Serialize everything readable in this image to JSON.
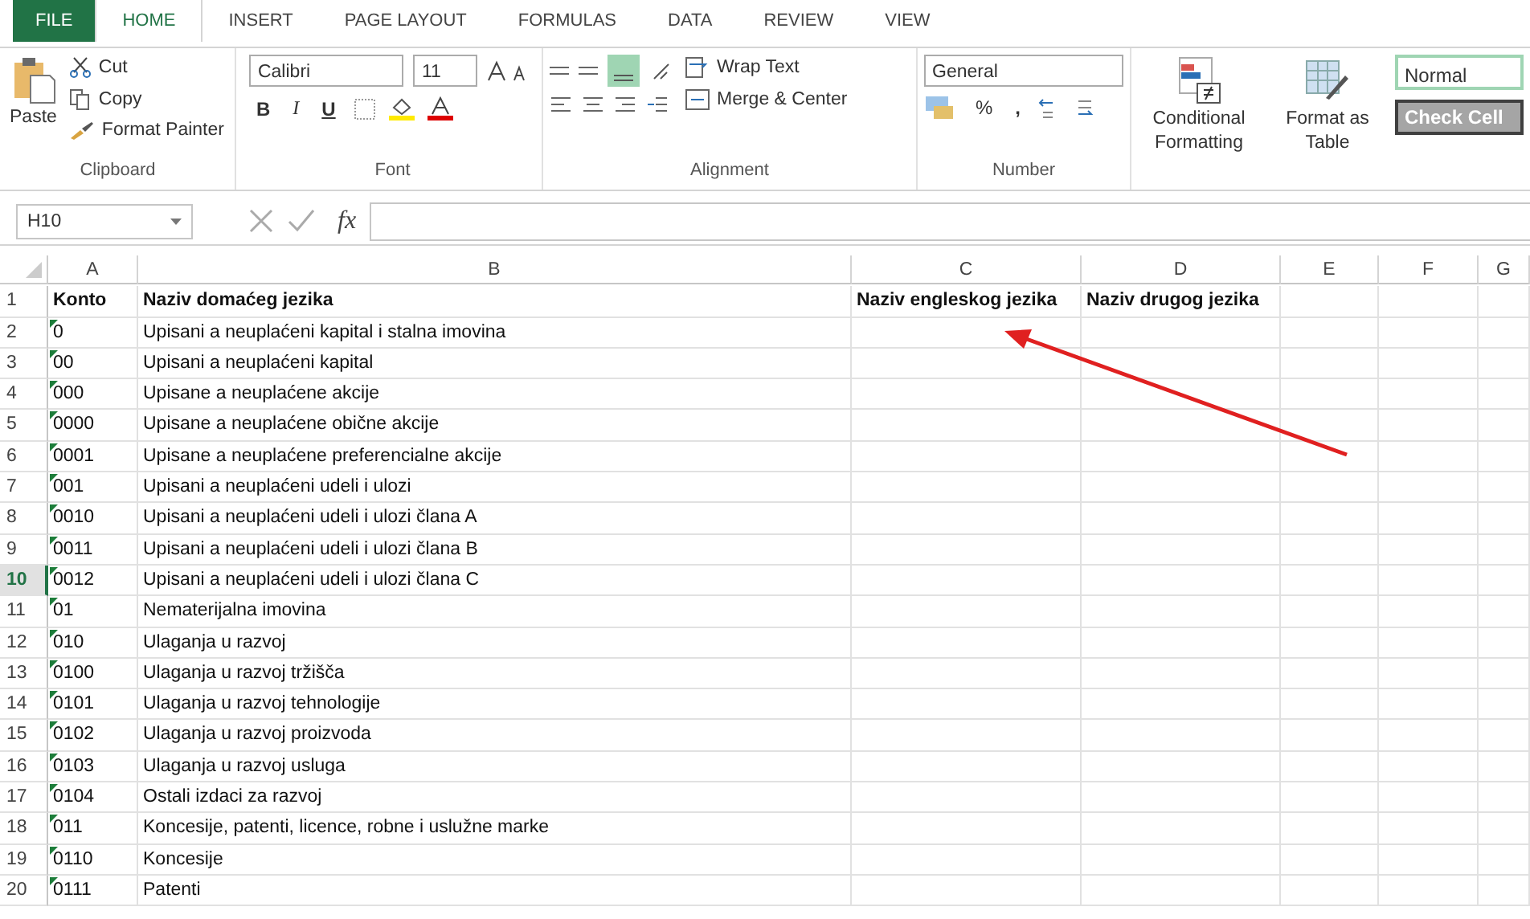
{
  "tabs": [
    {
      "label": "FILE",
      "kind": "file",
      "selected": false
    },
    {
      "label": "HOME",
      "kind": "tab",
      "selected": true
    },
    {
      "label": "INSERT",
      "kind": "tab",
      "selected": false
    },
    {
      "label": "PAGE LAYOUT",
      "kind": "tab",
      "selected": false
    },
    {
      "label": "FORMULAS",
      "kind": "tab",
      "selected": false
    },
    {
      "label": "DATA",
      "kind": "tab",
      "selected": false
    },
    {
      "label": "REVIEW",
      "kind": "tab",
      "selected": false
    },
    {
      "label": "VIEW",
      "kind": "tab",
      "selected": false
    }
  ],
  "ribbon": {
    "clipboard": {
      "paste": "Paste",
      "cut": "Cut",
      "copy": "Copy",
      "format_painter": "Format Painter",
      "label": "Clipboard"
    },
    "font": {
      "name": "Calibri",
      "size": "11",
      "bold": "B",
      "italic": "I",
      "underline": "U",
      "label": "Font"
    },
    "alignment": {
      "wrap": "Wrap Text",
      "merge": "Merge & Center",
      "label": "Alignment"
    },
    "number": {
      "format": "General",
      "percent": "%",
      "comma": ",",
      "label": "Number"
    },
    "styles": {
      "conditional": "Conditional Formatting",
      "format_table": "Format as Table",
      "normal": "Normal",
      "check_cell": "Check Cell"
    }
  },
  "formula_bar": {
    "name_box": "H10",
    "fx": "fx"
  },
  "columns": [
    "A",
    "B",
    "C",
    "D",
    "E",
    "F",
    "G"
  ],
  "rows": [
    {
      "number": "1",
      "kind": "header",
      "selected": false,
      "flagged": false,
      "cells": [
        "Konto",
        "Naziv domaćeg jezika",
        "Naziv engleskog jezika",
        "Naziv drugog jezika"
      ]
    },
    {
      "number": "2",
      "kind": "data",
      "selected": false,
      "flagged": true,
      "cells": [
        "0",
        "Upisani a neuplaćeni kapital i stalna imovina"
      ]
    },
    {
      "number": "3",
      "kind": "data",
      "selected": false,
      "flagged": true,
      "cells": [
        "00",
        "Upisani a neuplaćeni kapital"
      ]
    },
    {
      "number": "4",
      "kind": "data",
      "selected": false,
      "flagged": true,
      "cells": [
        "000",
        "Upisane a neuplaćene akcije"
      ]
    },
    {
      "number": "5",
      "kind": "data",
      "selected": false,
      "flagged": true,
      "cells": [
        "0000",
        "Upisane a neuplaćene obične akcije"
      ]
    },
    {
      "number": "6",
      "kind": "data",
      "selected": false,
      "flagged": true,
      "cells": [
        "0001",
        "Upisane a neuplaćene preferencialne akcije"
      ]
    },
    {
      "number": "7",
      "kind": "data",
      "selected": false,
      "flagged": true,
      "cells": [
        "001",
        "Upisani a neuplaćeni udeli i ulozi"
      ]
    },
    {
      "number": "8",
      "kind": "data",
      "selected": false,
      "flagged": true,
      "cells": [
        "0010",
        "Upisani a neuplaćeni udeli i ulozi člana A"
      ]
    },
    {
      "number": "9",
      "kind": "data",
      "selected": false,
      "flagged": true,
      "cells": [
        "0011",
        "Upisani a neuplaćeni udeli i ulozi člana B"
      ]
    },
    {
      "number": "10",
      "kind": "data",
      "selected": true,
      "flagged": true,
      "cells": [
        "0012",
        "Upisani a neuplaćeni udeli i ulozi člana C"
      ]
    },
    {
      "number": "11",
      "kind": "data",
      "selected": false,
      "flagged": true,
      "cells": [
        "01",
        "Nematerijalna imovina"
      ]
    },
    {
      "number": "12",
      "kind": "data",
      "selected": false,
      "flagged": true,
      "cells": [
        "010",
        "Ulaganja u razvoj"
      ]
    },
    {
      "number": "13",
      "kind": "data",
      "selected": false,
      "flagged": true,
      "cells": [
        "0100",
        "Ulaganja u razvoj tržišča"
      ]
    },
    {
      "number": "14",
      "kind": "data",
      "selected": false,
      "flagged": true,
      "cells": [
        "0101",
        "Ulaganja u razvoj tehnologije"
      ]
    },
    {
      "number": "15",
      "kind": "data",
      "selected": false,
      "flagged": true,
      "cells": [
        "0102",
        "Ulaganja u razvoj proizvoda"
      ]
    },
    {
      "number": "16",
      "kind": "data",
      "selected": false,
      "flagged": true,
      "cells": [
        "0103",
        "Ulaganja u razvoj usluga"
      ]
    },
    {
      "number": "17",
      "kind": "data",
      "selected": false,
      "flagged": true,
      "cells": [
        "0104",
        "Ostali izdaci za razvoj"
      ]
    },
    {
      "number": "18",
      "kind": "data",
      "selected": false,
      "flagged": true,
      "cells": [
        "011",
        "Koncesije, patenti, licence, robne i uslužne marke"
      ]
    },
    {
      "number": "19",
      "kind": "data",
      "selected": false,
      "flagged": true,
      "cells": [
        "0110",
        "Koncesije"
      ]
    },
    {
      "number": "20",
      "kind": "data",
      "selected": false,
      "flagged": true,
      "cells": [
        "0111",
        "Patenti"
      ]
    }
  ]
}
